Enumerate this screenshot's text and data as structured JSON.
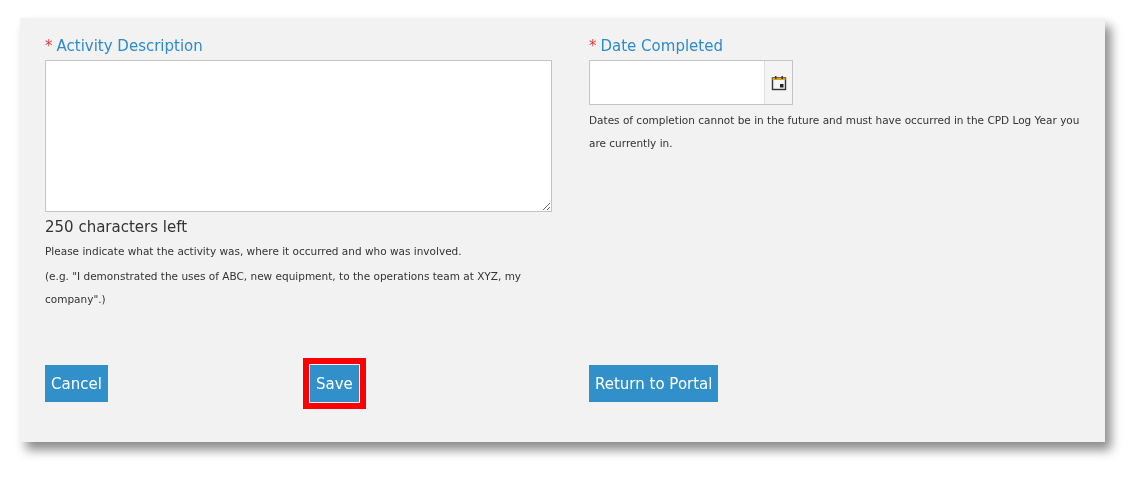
{
  "description": {
    "label": "Activity Description",
    "required_mark": "*",
    "chars_left": "250 characters left",
    "hints": [
      "Please indicate what the activity was, where it occurred and who was involved.",
      "(e.g. \"I demonstrated the uses of ABC, new equipment, to the operations team at XYZ, my company\".)"
    ]
  },
  "date": {
    "label": "Date Completed",
    "required_mark": "*",
    "hint": "Dates of completion cannot be in the future and must have occurred in the CPD Log Year you are currently in."
  },
  "buttons": [
    {
      "label": "Cancel",
      "highlighted": false
    },
    {
      "label": "Save",
      "highlighted": true
    },
    {
      "label": "Return to Portal",
      "highlighted": false
    }
  ]
}
